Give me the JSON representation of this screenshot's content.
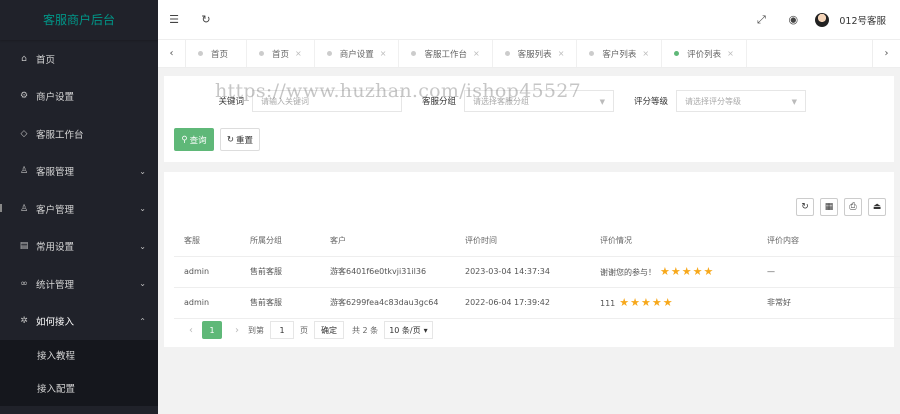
{
  "sidebar": {
    "logo": "客服商户后台",
    "items": [
      {
        "icon": "⌂",
        "label": "首页",
        "arrow": ""
      },
      {
        "icon": "⚙",
        "label": "商户设置",
        "arrow": ""
      },
      {
        "icon": "◇",
        "label": "客服工作台",
        "arrow": ""
      },
      {
        "icon": "♙",
        "label": "客服管理",
        "arrow": "⌄"
      },
      {
        "icon": "♙",
        "label": "客户管理",
        "arrow": "⌄"
      },
      {
        "icon": "▤",
        "label": "常用设置",
        "arrow": "⌄"
      },
      {
        "icon": "∞",
        "label": "统计管理",
        "arrow": "⌄"
      },
      {
        "icon": "✲",
        "label": "如何接入",
        "arrow": "⌃"
      }
    ],
    "subitems": [
      "接入教程",
      "接入配置"
    ]
  },
  "header": {
    "menu_icon": "☰",
    "refresh_icon": "↻",
    "fullscreen_icon": "⤢",
    "globe_icon": "◉",
    "username": "012号客服"
  },
  "tabs": {
    "left_arrow": "‹",
    "right_arrow": "›",
    "items": [
      {
        "label": "首页",
        "close": ""
      },
      {
        "label": "首页",
        "close": "×"
      },
      {
        "label": "商户设置",
        "close": "×"
      },
      {
        "label": "客服工作台",
        "close": "×"
      },
      {
        "label": "客服列表",
        "close": "×"
      },
      {
        "label": "客户列表",
        "close": "×"
      },
      {
        "label": "评价列表",
        "close": "×"
      }
    ]
  },
  "search": {
    "keyword_label": "关键词",
    "keyword_placeholder": "请输入关键词",
    "group_label": "客服分组",
    "group_placeholder": "请选择客服分组",
    "level_label": "评分等级",
    "level_placeholder": "请选择评分等级",
    "query_button": "查询",
    "reset_button": "重置"
  },
  "watermark": "https://www.huzhan.com/ishop45527",
  "toolbar": {
    "refresh": "↻",
    "columns": "▦",
    "print": "⎙",
    "export": "⏏"
  },
  "table": {
    "headers": [
      "客服",
      "所属分组",
      "客户",
      "评价时间",
      "评价情况",
      "评价内容"
    ],
    "rows": [
      {
        "agent": "admin",
        "group": "售前客服",
        "customer": "游客6401f6e0tkvji31il36",
        "time": "2023-03-04 14:37:34",
        "rating_text": "谢谢您的参与！",
        "stars": 5,
        "content": "—"
      },
      {
        "agent": "admin",
        "group": "售前客服",
        "customer": "游客6299fea4c83dau3gc64",
        "time": "2022-06-04 17:39:42",
        "rating_text": "111",
        "stars": 5,
        "content": "非常好"
      }
    ]
  },
  "pager": {
    "prev": "‹",
    "current": "1",
    "next": "›",
    "goto_label": "到第",
    "goto_value": "1",
    "page_unit": "页",
    "confirm": "确定",
    "total": "共 2 条",
    "page_size": "10 条/页"
  },
  "colors": {
    "sidebar_bg": "#20222a",
    "accent_green": "#5fb878",
    "logo_teal": "#009688",
    "star": "#f7a81b"
  }
}
